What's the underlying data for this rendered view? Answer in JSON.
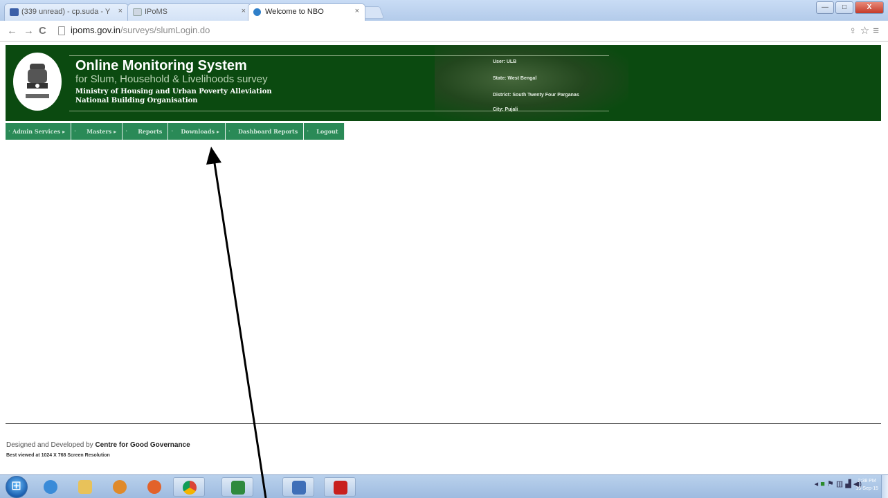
{
  "browser": {
    "tabs": [
      {
        "title": "(339 unread) - cp.suda - Y",
        "icon_color": "#3b5fa8"
      },
      {
        "title": "IPoMS",
        "icon_color": "#cfd7e2"
      },
      {
        "title": "Welcome to NBO",
        "icon_color": "#2f7fc9"
      }
    ],
    "tab_close_glyph": "×",
    "url_domain": "ipoms.gov.in",
    "url_path": "/surveys/slumLogin.do",
    "window_buttons": {
      "minimize": "—",
      "maximize": "□",
      "close": "X"
    }
  },
  "header": {
    "title": "Online Monitoring System",
    "subtitle": "for Slum, Household & Livelihoods survey",
    "ministry": "Ministry of Housing and Urban Poverty Alleviation",
    "org": "National Building Organisation",
    "user_info": [
      "User: ULB",
      "State: West Bengal",
      "District: South Twenty Four Parganas",
      "City: Pujali"
    ],
    "bg_color": "#0b4a10"
  },
  "menu": [
    {
      "label": "Admin Services",
      "submenu": true
    },
    {
      "label": "Masters",
      "submenu": true
    },
    {
      "label": "Reports",
      "submenu": false
    },
    {
      "label": "Downloads",
      "submenu": true
    },
    {
      "label": "Dashboard Reports",
      "submenu": false
    },
    {
      "label": "Logout",
      "submenu": false
    }
  ],
  "menu_arrow": "▸",
  "footer": {
    "designed_prefix": "Designed and Developed by ",
    "designed_org": "Centre for Good Governance",
    "resolution_note": "Best viewed at 1024 X 768 Screen Resolution"
  },
  "taskbar": {
    "apps": [
      {
        "name": "internet-explorer-icon",
        "color": "#3a8bd8"
      },
      {
        "name": "file-explorer-icon",
        "color": "#e8c25a"
      },
      {
        "name": "media-player-icon",
        "color": "#e08a2a"
      },
      {
        "name": "firefox-icon",
        "color": "#e2622a"
      },
      {
        "name": "chrome-icon",
        "color": "#3aa14a"
      },
      {
        "name": "excel-icon",
        "color": "#2f8a3e"
      },
      {
        "name": "document-icon",
        "color": "#3f6fb8"
      },
      {
        "name": "adobe-reader-icon",
        "color": "#c8201e"
      }
    ],
    "time": "2:38 PM",
    "date": "15-Sep-15"
  }
}
